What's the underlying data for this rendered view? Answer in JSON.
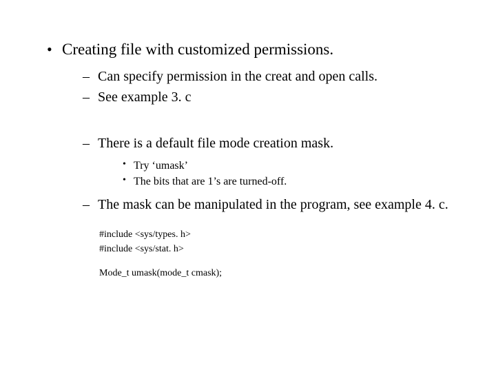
{
  "heading": "Creating file with customized permissions.",
  "sub1": "Can specify permission in the creat and open calls.",
  "sub2": "See example 3. c",
  "sub3": "There is a default file mode creation mask.",
  "sub3a": "Try ‘umask’",
  "sub3b": "The bits that are 1’s are turned-off.",
  "sub4": "The mask can be manipulated in the program, see example 4. c.",
  "code1": "#include <sys/types. h>",
  "code2": "#include <sys/stat. h>",
  "code3": "Mode_t umask(mode_t cmask);"
}
